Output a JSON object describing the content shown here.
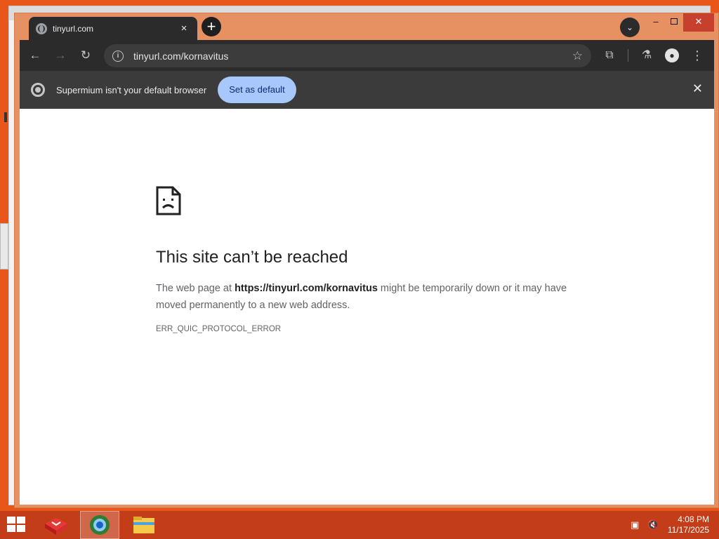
{
  "browser": {
    "tab": {
      "title": "tinyurl.com",
      "close_glyph": "×"
    },
    "new_tab_glyph": "+",
    "tab_search_glyph": "⌄",
    "window_controls": {
      "minimize": "–",
      "close": "✕"
    },
    "toolbar": {
      "back_glyph": "←",
      "forward_glyph": "→",
      "reload_glyph": "↻",
      "info_glyph": "i",
      "url": "tinyurl.com/kornavitus",
      "star_glyph": "☆",
      "extensions_glyph": "⧉",
      "labs_glyph": "⚗",
      "profile_glyph": "●",
      "menu_glyph": "⋮"
    },
    "infobar": {
      "message": "Supermium isn't your default browser",
      "button": "Set as default",
      "close_glyph": "✕"
    }
  },
  "error_page": {
    "title": "This site can’t be reached",
    "desc_prefix": "The web page at ",
    "desc_url": "https://tinyurl.com/kornavitus",
    "desc_suffix": " might be temporarily down or it may have moved permanently to a new web address.",
    "error_code": "ERR_QUIC_PROTOCOL_ERROR"
  },
  "taskbar": {
    "apps": [
      "store-icon",
      "supermium-icon",
      "file-explorer-icon"
    ],
    "time": "4:08 PM",
    "date": "11/17/2025"
  },
  "colors": {
    "desktop_accent": "#e8561a",
    "window_frame": "#e79163",
    "toolbar": "#2b2b2b",
    "primary_button": "#a8c7fa",
    "taskbar": "#c33d18"
  }
}
